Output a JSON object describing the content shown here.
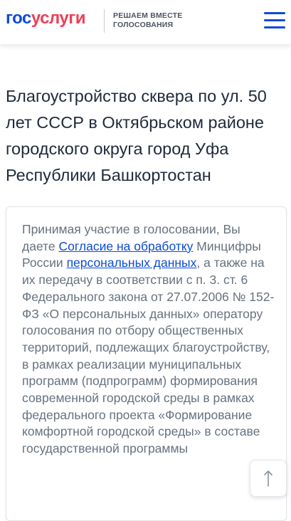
{
  "header": {
    "logo_part1": "гос",
    "logo_part2": "услуги",
    "tagline_line1": "РЕШАЕМ ВМЕСТЕ",
    "tagline_line2": "ГОЛОСОВАНИЯ",
    "menu_icon": "hamburger-menu-icon"
  },
  "page": {
    "title": "Благоустройство сквера по ул. 50 лет СССР в Октябрьском районе городского округа город Уфа Республики Башкортостан"
  },
  "consent": {
    "text_1": "Принимая участие в голосовании, Вы даете ",
    "link_1": "Согласие на обработку",
    "text_2": " Минцифры России ",
    "link_2": "персональных данных",
    "text_3": ", а также на их передачу в соответствии с п. 3. ст. 6 Федерального закона от 27.07.2006 № 152-ФЗ «О персональных данных» оператору голосования по отбору общественных территорий, подлежащих благоустройству, в рамках реализации муниципальных программ (подпрограмм) формирования современной городской среды в рамках федерального проекта «Формирование комфортной городской среды» в составе государственной программы"
  },
  "scroll_top": {
    "icon": "arrow-up-icon"
  },
  "colors": {
    "brand_blue": "#0d4cd3",
    "brand_red": "#ee3f58",
    "title_text": "#1f2a3a",
    "body_text": "#66727f"
  }
}
